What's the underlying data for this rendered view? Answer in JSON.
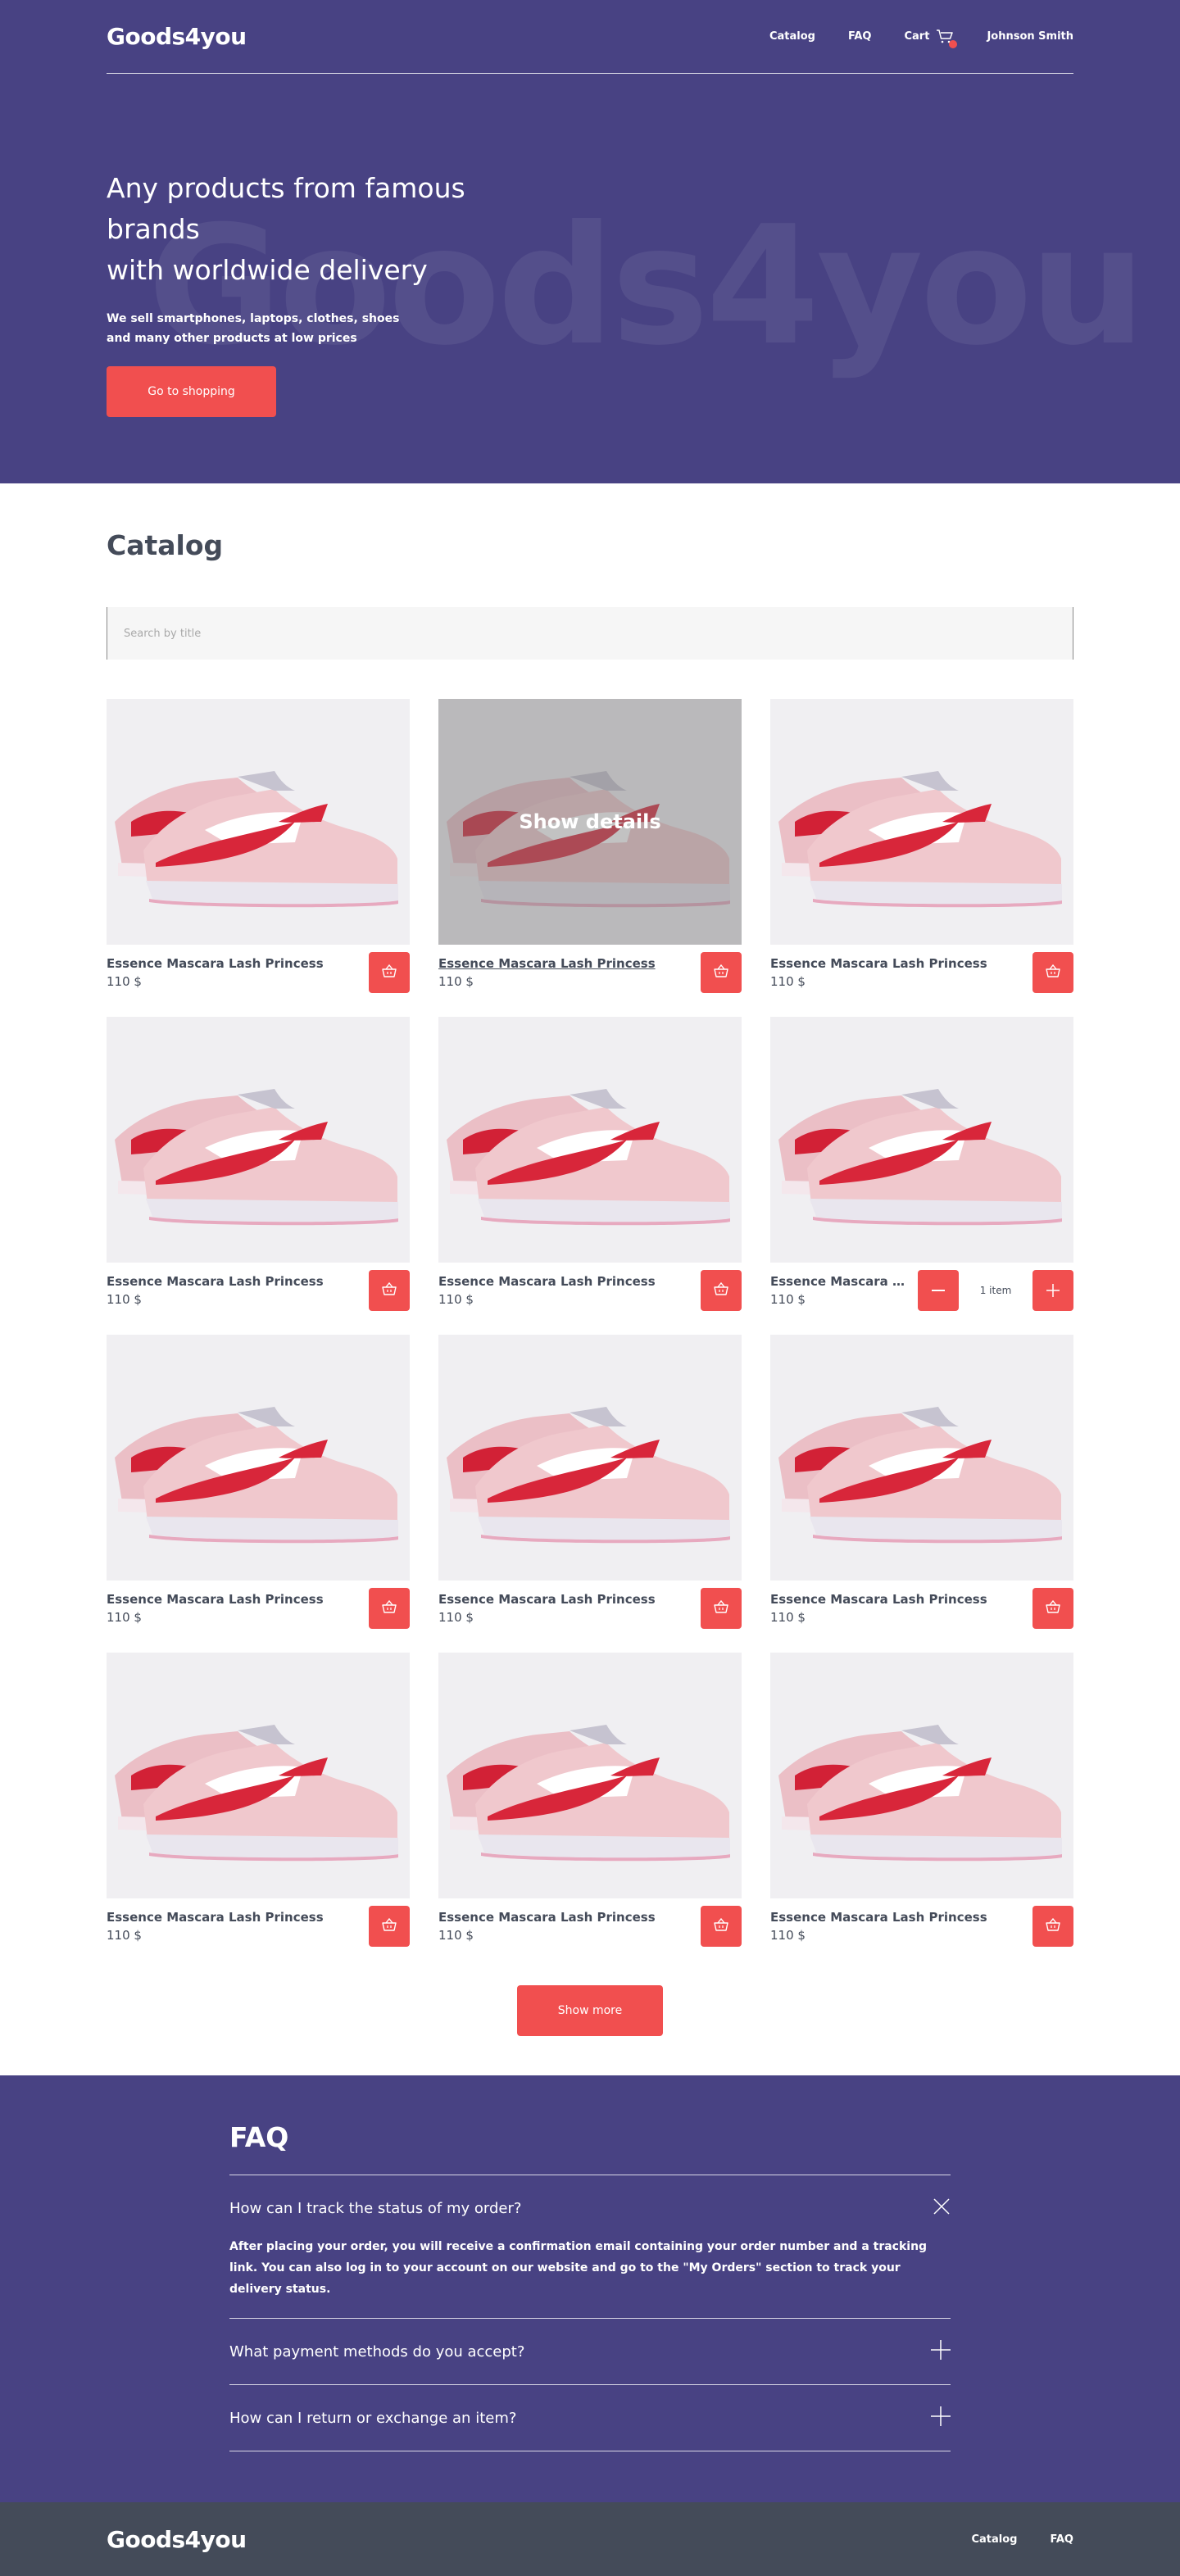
{
  "header": {
    "logo": "Goods4you",
    "nav": {
      "catalog": "Catalog",
      "faq": "FAQ",
      "cart": "Cart",
      "user": "Johnson Smith"
    },
    "cart_count": 1
  },
  "hero": {
    "background_text": "Goods4you",
    "title_line1": "Any products from famous brands",
    "title_line2": "with worldwide delivery",
    "subtitle_line1": "We sell smartphones, laptops, clothes, shoes",
    "subtitle_line2": "and many other products at low prices",
    "button": "Go to shopping"
  },
  "catalog": {
    "title": "Catalog",
    "search_placeholder": "Search by title",
    "hover_label": "Show details",
    "products": [
      {
        "title": "Essence Mascara Lash Princess",
        "price": "110 $"
      },
      {
        "title": "Essence Mascara Lash Princess",
        "price": "110 $"
      },
      {
        "title": "Essence Mascara Lash Princess",
        "price": "110 $"
      },
      {
        "title": "Essence Mascara Lash Princess",
        "price": "110 $"
      },
      {
        "title": "Essence Mascara Lash Princess",
        "price": "110 $"
      },
      {
        "title": "Essence Mascara Lash Princess",
        "price": "110 $",
        "in_cart": "1 item"
      },
      {
        "title": "Essence Mascara Lash Princess",
        "price": "110 $"
      },
      {
        "title": "Essence Mascara Lash Princess",
        "price": "110 $"
      },
      {
        "title": "Essence Mascara Lash Princess",
        "price": "110 $"
      },
      {
        "title": "Essence Mascara Lash Princess",
        "price": "110 $"
      },
      {
        "title": "Essence Mascara Lash Princess",
        "price": "110 $"
      },
      {
        "title": "Essence Mascara Lash Princess",
        "price": "110 $"
      }
    ],
    "show_more": "Show more"
  },
  "faq": {
    "title": "FAQ",
    "items": [
      {
        "question": "How can I track the status of my order?",
        "answer": "After placing your order, you will receive a confirmation email containing your order number and a tracking link. You can also log in to your account on our website and go to the \"My Orders\" section to track your delivery status.",
        "open": true
      },
      {
        "question": "What payment methods do you accept?",
        "open": false
      },
      {
        "question": "How can I return or exchange an item?",
        "open": false
      }
    ]
  },
  "footer": {
    "logo": "Goods4you",
    "nav": {
      "catalog": "Catalog",
      "faq": "FAQ"
    }
  },
  "colors": {
    "brand_purple": "#484283",
    "accent_red": "#F14F4F",
    "footer_gray": "#444B59",
    "text_dark": "#444B59"
  },
  "icons": {
    "cart": "cart-icon",
    "basket": "basket-icon",
    "close": "close-icon",
    "plus": "plus-icon",
    "minus": "minus-icon",
    "sneaker": "sneaker-image"
  }
}
